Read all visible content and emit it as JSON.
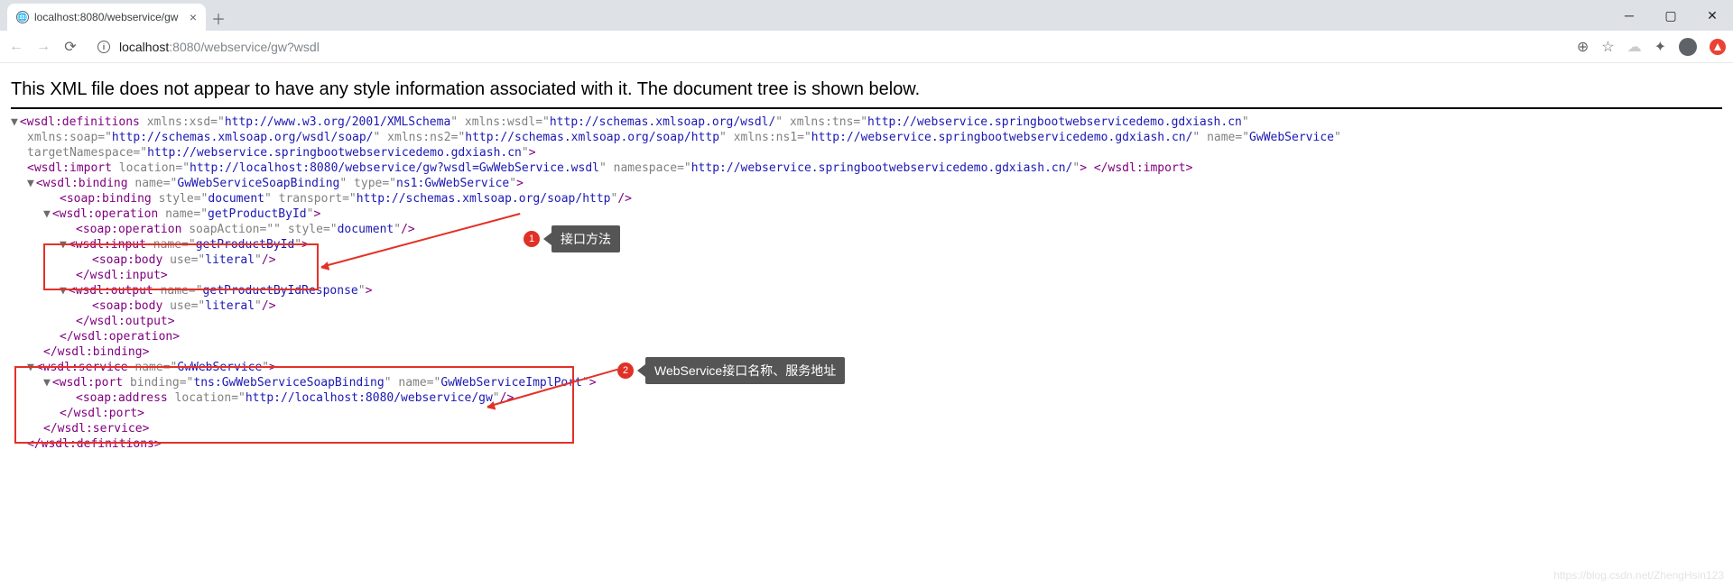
{
  "browser": {
    "tab_title": "localhost:8080/webservice/gw",
    "url_host": "localhost",
    "url_port": ":8080",
    "url_path": "/webservice/gw?wsdl"
  },
  "message": "This XML file does not appear to have any style information associated with it. The document tree is shown below.",
  "attrs": {
    "xsd": "http://www.w3.org/2001/XMLSchema",
    "wsdl": "http://schemas.xmlsoap.org/wsdl/",
    "tns": "http://webservice.springbootwebservicedemo.gdxiash.cn",
    "soap": "http://schemas.xmlsoap.org/wsdl/soap/",
    "ns2": "http://schemas.xmlsoap.org/soap/http",
    "ns1": "http://webservice.springbootwebservicedemo.gdxiash.cn/",
    "serviceName": "GwWebService",
    "targetNs": "http://webservice.springbootwebservicedemo.gdxiash.cn",
    "importLoc": "http://localhost:8080/webservice/gw?wsdl=GwWebService.wsdl",
    "importNs": "http://webservice.springbootwebservicedemo.gdxiash.cn/",
    "bindingName": "GwWebServiceSoapBinding",
    "bindingType": "ns1:GwWebService",
    "soapStyle": "document",
    "soapTransport": "http://schemas.xmlsoap.org/soap/http",
    "opName": "getProductById",
    "inputName": "getProductById",
    "bodyUse": "literal",
    "outputName": "getProductByIdResponse",
    "portBinding": "tns:GwWebServiceSoapBinding",
    "portName": "GwWebServiceImplPort",
    "addrLoc": "http://localhost:8080/webservice/gw"
  },
  "annotations": {
    "a1_num": "1",
    "a1_label": "接口方法",
    "a2_num": "2",
    "a2_label": "WebService接口名称、服务地址"
  },
  "watermark": "https://blog.csdn.net/ZhengHsin123"
}
